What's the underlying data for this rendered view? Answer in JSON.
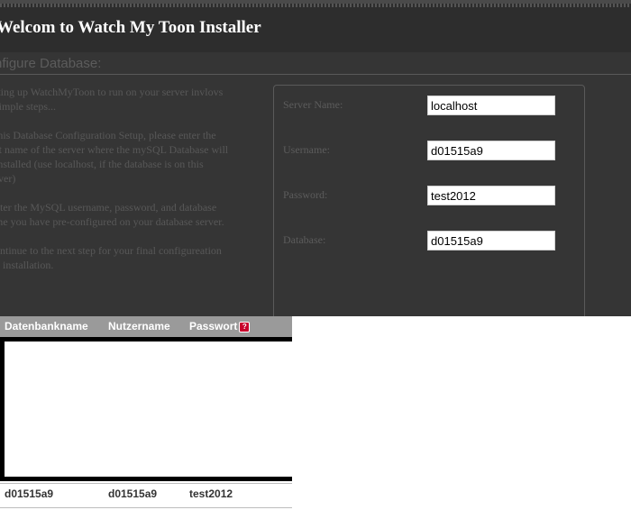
{
  "installer": {
    "title": "Welcom to Watch My Toon Installer",
    "section_title": "nfigure Database:",
    "intro": [
      "tting up WatchMyToon to run on your server invlovs\nsimple steps...",
      "this Database Configuration Setup, please enter the\nst name of the server where the mySQL Database will\ninstalled (use localhost, if the database is on this\nrver)",
      "nter the MySQL username, password, and database\nme you have pre-configured on your database server.",
      "ontinue to the next step for your final configureation\nd installation."
    ],
    "form": [
      {
        "label": "Server Name:",
        "value": "localhost"
      },
      {
        "label": "Username:",
        "value": "d01515a9"
      },
      {
        "label": "Password:",
        "value": "test2012"
      },
      {
        "label": "Database:",
        "value": "d01515a9"
      }
    ]
  },
  "credentials": {
    "headers": [
      "Datenbankname",
      "Nutzername",
      "Passwort"
    ],
    "help_icon": "?",
    "row": [
      "d01515a9",
      "d01515a9",
      "test2012"
    ]
  }
}
